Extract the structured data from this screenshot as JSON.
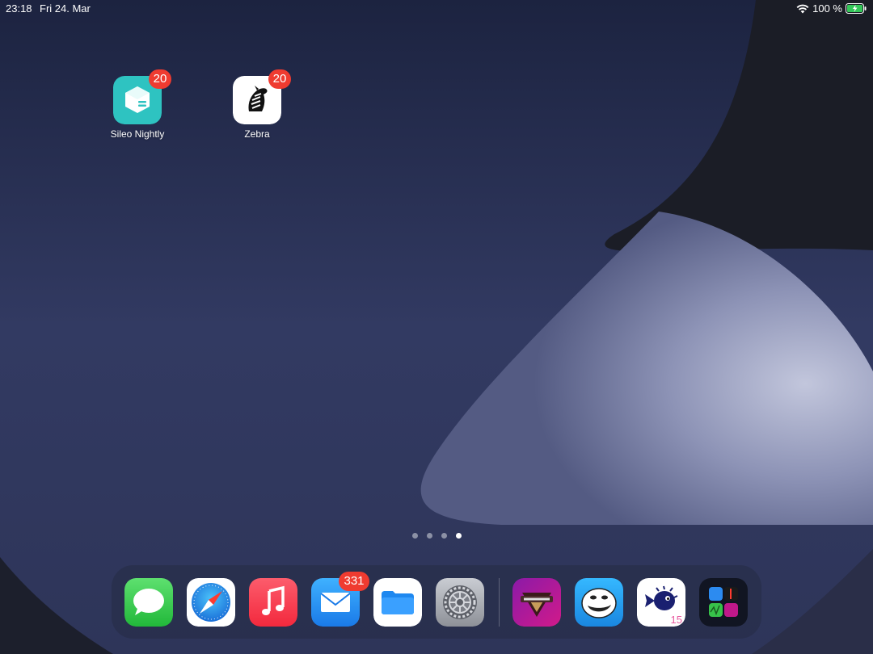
{
  "status_bar": {
    "time": "23:18",
    "date": "Fri 24. Mar",
    "battery_percent": "100 %",
    "wifi_icon": "wifi-icon",
    "battery_icon": "battery-charging-icon"
  },
  "home_apps": [
    {
      "label": "Sileo Nightly",
      "badge": "20",
      "icon": "sileo-icon"
    },
    {
      "label": "Zebra",
      "badge": "20",
      "icon": "zebra-icon"
    }
  ],
  "page_indicator": {
    "pages": 4,
    "current": 4
  },
  "dock": {
    "apps": [
      {
        "icon": "messages-icon"
      },
      {
        "icon": "safari-icon"
      },
      {
        "icon": "music-icon"
      },
      {
        "icon": "mail-icon",
        "badge": "331"
      },
      {
        "icon": "files-icon"
      },
      {
        "icon": "settings-icon"
      },
      {
        "icon": "tweak-app-icon"
      },
      {
        "icon": "trollface-icon"
      },
      {
        "icon": "pufferfish-icon",
        "small_label": "15"
      },
      {
        "icon": "app-folder-icon"
      }
    ]
  },
  "colors": {
    "badge": "#ef3b30",
    "sileo": "#2ec3c1",
    "messages": "#34c759",
    "music": "#fa3c4f",
    "mail": "#1a8cf5",
    "files": "#1e88f0"
  }
}
